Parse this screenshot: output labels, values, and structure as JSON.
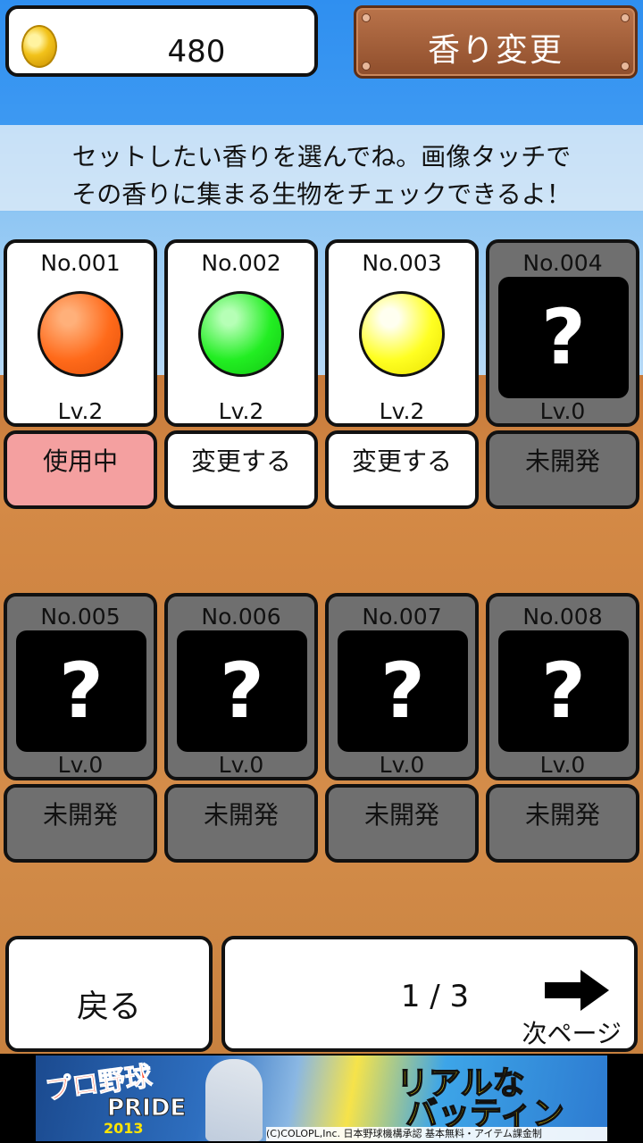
{
  "coins": {
    "count": "480",
    "icon": "coin-icon"
  },
  "header": {
    "change_button": "香り変更"
  },
  "instructions": {
    "line1": "セットしたい香りを選んでね。画像タッチで",
    "line2": "その香りに集まる生物をチェックできるよ！"
  },
  "scents": [
    {
      "no": "No.001",
      "lv": "Lv.2",
      "color": "#ff6a1a",
      "action": "使用中",
      "state": "in_use"
    },
    {
      "no": "No.002",
      "lv": "Lv.2",
      "color": "#22ee22",
      "action": "変更する",
      "state": "available"
    },
    {
      "no": "No.003",
      "lv": "Lv.2",
      "color": "#ffff22",
      "action": "変更する",
      "state": "available"
    },
    {
      "no": "No.004",
      "lv": "Lv.0",
      "locked_mark": "?",
      "action": "未開発",
      "state": "locked"
    },
    {
      "no": "No.005",
      "lv": "Lv.0",
      "locked_mark": "?",
      "action": "未開発",
      "state": "locked"
    },
    {
      "no": "No.006",
      "lv": "Lv.0",
      "locked_mark": "?",
      "action": "未開発",
      "state": "locked"
    },
    {
      "no": "No.007",
      "lv": "Lv.0",
      "locked_mark": "?",
      "action": "未開発",
      "state": "locked"
    },
    {
      "no": "No.008",
      "lv": "Lv.0",
      "locked_mark": "?",
      "action": "未開発",
      "state": "locked"
    }
  ],
  "footer": {
    "back": "戻る",
    "page_indicator": "1 / 3",
    "next": "次ページ",
    "next_icon": "right-arrow-icon"
  },
  "ad": {
    "left_title": "プロ野球",
    "left_sub": "PRIDE",
    "year": "2013",
    "headline1": "リアルな",
    "headline2": "バッティング!!",
    "footer": "(C)COLOPL,Inc.  日本野球機構承認  基本無料・アイテム課金制"
  }
}
